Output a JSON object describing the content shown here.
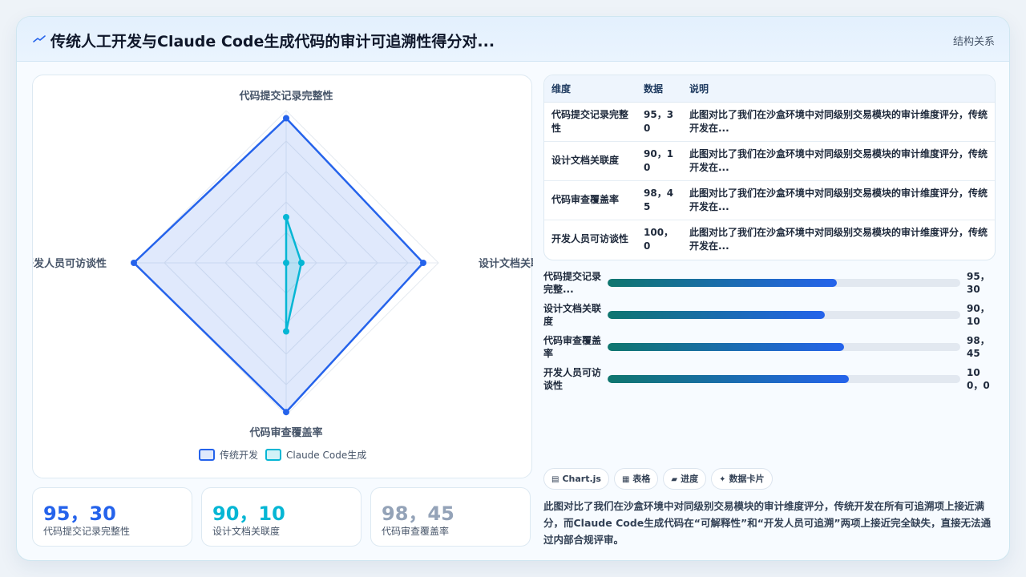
{
  "header": {
    "title": "传统人工开发与Claude Code生成代码的审计可追溯性得分对...",
    "tag": "结构关系",
    "icon": "trend-line-icon"
  },
  "chart_data": {
    "type": "radar",
    "axes": [
      "代码提交记录完整性",
      "设计文档关联度",
      "代码审查覆盖率",
      "开发人员可访谈性"
    ],
    "series": [
      {
        "name": "传统开发",
        "values": [
          95,
          90,
          98,
          100
        ],
        "color": "#2563eb"
      },
      {
        "name": "Claude Code生成",
        "values": [
          30,
          10,
          45,
          0
        ],
        "color": "#06b6d4"
      }
    ],
    "range": [
      0,
      100
    ],
    "grid_levels": 5,
    "legend_position": "bottom"
  },
  "stats": [
    {
      "value": "95，30",
      "label": "代码提交记录完整性",
      "color": "#2563eb"
    },
    {
      "value": "90，10",
      "label": "设计文档关联度",
      "color": "#06b6d4"
    },
    {
      "value": "98，45",
      "label": "代码审查覆盖率",
      "color": "#94a3b8"
    }
  ],
  "table": {
    "headers": [
      "维度",
      "数据",
      "说明"
    ],
    "rows": [
      {
        "dim": "代码提交记录完整性",
        "data": "95，30",
        "desc": "此图对比了我们在沙盒环境中对同级别交易模块的审计维度评分，传统开发在..."
      },
      {
        "dim": "设计文档关联度",
        "data": "90，10",
        "desc": "此图对比了我们在沙盒环境中对同级别交易模块的审计维度评分，传统开发在..."
      },
      {
        "dim": "代码审查覆盖率",
        "data": "98，45",
        "desc": "此图对比了我们在沙盒环境中对同级别交易模块的审计维度评分，传统开发在..."
      },
      {
        "dim": "开发人员可访谈性",
        "data": "100，0",
        "desc": "此图对比了我们在沙盒环境中对同级别交易模块的审计维度评分，传统开发在..."
      }
    ]
  },
  "progress": [
    {
      "label": "代码提交记录完整...",
      "value": "95，30",
      "fraction": 0.65
    },
    {
      "label": "设计文档关联度",
      "value": "90，10",
      "fraction": 0.615
    },
    {
      "label": "代码审查覆盖率",
      "value": "98，45",
      "fraction": 0.67
    },
    {
      "label": "开发人员可访谈性",
      "value": "100，0",
      "fraction": 0.685
    }
  ],
  "chips": [
    {
      "icon": "▤",
      "label": "Chart.js"
    },
    {
      "icon": "▦",
      "label": "表格"
    },
    {
      "icon": "▰",
      "label": "进度"
    },
    {
      "icon": "✦",
      "label": "数据卡片"
    }
  ],
  "description": "此图对比了我们在沙盒环境中对同级别交易模块的审计维度评分，传统开发在所有可追溯项上接近满分，而Claude Code生成代码在“可解释性”和“开发人员可追溯”两项上接近完全缺失，直接无法通过内部合规评审。"
}
